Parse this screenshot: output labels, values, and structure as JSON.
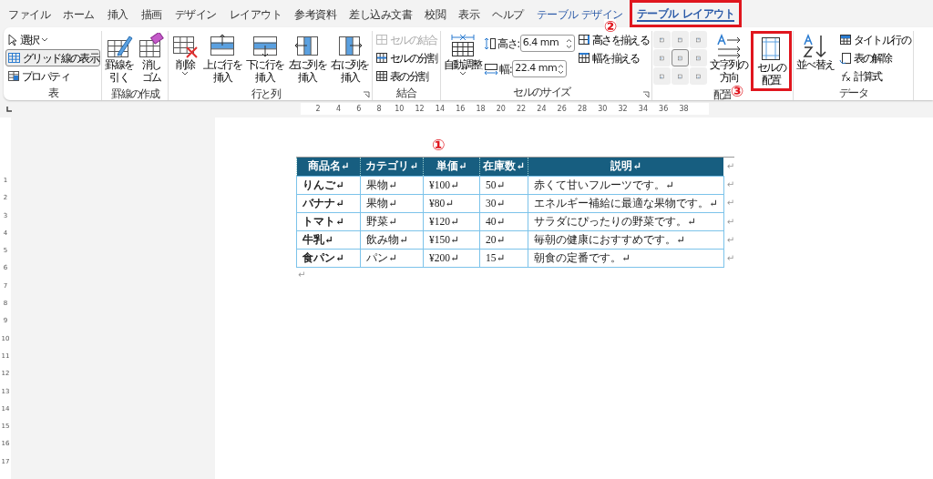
{
  "menu_tabs": [
    {
      "label": "ファイル",
      "kind": "normal",
      "selected": false,
      "highlighted": false
    },
    {
      "label": "ホーム",
      "kind": "normal",
      "selected": false,
      "highlighted": false
    },
    {
      "label": "挿入",
      "kind": "normal",
      "selected": false,
      "highlighted": false
    },
    {
      "label": "描画",
      "kind": "normal",
      "selected": false,
      "highlighted": false
    },
    {
      "label": "デザイン",
      "kind": "normal",
      "selected": false,
      "highlighted": false
    },
    {
      "label": "レイアウト",
      "kind": "normal",
      "selected": false,
      "highlighted": false
    },
    {
      "label": "参考資料",
      "kind": "normal",
      "selected": false,
      "highlighted": false
    },
    {
      "label": "差し込み文書",
      "kind": "normal",
      "selected": false,
      "highlighted": false
    },
    {
      "label": "校閲",
      "kind": "normal",
      "selected": false,
      "highlighted": false
    },
    {
      "label": "表示",
      "kind": "normal",
      "selected": false,
      "highlighted": false
    },
    {
      "label": "ヘルプ",
      "kind": "normal",
      "selected": false,
      "highlighted": false
    },
    {
      "label": "テーブル デザイン",
      "kind": "contextual",
      "selected": false,
      "highlighted": false
    },
    {
      "label": "テーブル レイアウト",
      "kind": "contextual",
      "selected": true,
      "highlighted": true
    }
  ],
  "ribbon": {
    "groups": [
      {
        "label": "表",
        "items": [
          {
            "kind": "small-dropdown",
            "label": "選択",
            "selected": false,
            "disabled": false
          },
          {
            "kind": "small",
            "label": "グリッド線の表示",
            "selected": true,
            "disabled": false
          },
          {
            "kind": "small",
            "label": "プロパティ",
            "selected": false,
            "disabled": false
          }
        ]
      },
      {
        "label": "罫線の作成",
        "items": [
          {
            "kind": "large",
            "lines": [
              "罫線を",
              "引く"
            ],
            "highlighted": false
          },
          {
            "kind": "large",
            "lines": [
              "消し",
              "ゴム"
            ],
            "highlighted": false
          }
        ]
      },
      {
        "label": "行と列",
        "launcher": true,
        "items": [
          {
            "kind": "large-dropdown",
            "lines": [
              "削除"
            ],
            "highlighted": false
          },
          {
            "kind": "large",
            "lines": [
              "上に行を",
              "挿入"
            ],
            "highlighted": false
          },
          {
            "kind": "large",
            "lines": [
              "下に行を",
              "挿入"
            ],
            "highlighted": false
          },
          {
            "kind": "large",
            "lines": [
              "左に列を",
              "挿入"
            ],
            "highlighted": false
          },
          {
            "kind": "large",
            "lines": [
              "右に列を",
              "挿入"
            ],
            "highlighted": false
          }
        ]
      },
      {
        "label": "結合",
        "items": [
          {
            "kind": "small",
            "label": "セルの結合",
            "selected": false,
            "disabled": true
          },
          {
            "kind": "small",
            "label": "セルの分割",
            "selected": false,
            "disabled": false
          },
          {
            "kind": "small",
            "label": "表の分割",
            "selected": false,
            "disabled": false
          }
        ]
      },
      {
        "label": "セルのサイズ",
        "launcher": true,
        "items": [
          {
            "kind": "large-dropdown",
            "lines": [
              "自動調整"
            ],
            "highlighted": false
          },
          {
            "kind": "field",
            "label": "高さ:",
            "value": "6.4 mm"
          },
          {
            "kind": "field",
            "label": "幅:",
            "value": "22.4 mm"
          },
          {
            "kind": "small",
            "label": "高さを揃える",
            "selected": false,
            "disabled": false
          },
          {
            "kind": "small",
            "label": "幅を揃える",
            "selected": false,
            "disabled": false
          }
        ]
      },
      {
        "label": "配置",
        "items": [
          {
            "kind": "align-grid",
            "cells": [
              {
                "selected": false
              },
              {
                "selected": false
              },
              {
                "selected": false
              },
              {
                "selected": false
              },
              {
                "selected": true
              },
              {
                "selected": false
              },
              {
                "selected": false
              },
              {
                "selected": false
              },
              {
                "selected": false
              }
            ]
          },
          {
            "kind": "large",
            "lines": [
              "文字列の",
              "方向"
            ],
            "highlighted": false
          },
          {
            "kind": "large",
            "lines": [
              "セルの",
              "配置"
            ],
            "highlighted": true
          }
        ]
      },
      {
        "label": "データ",
        "items": [
          {
            "kind": "large",
            "lines": [
              "並べ替え"
            ],
            "highlighted": false
          },
          {
            "kind": "small",
            "label": "タイトル行の",
            "selected": false,
            "disabled": false
          },
          {
            "kind": "small",
            "label": "表の解除",
            "selected": false,
            "disabled": false
          },
          {
            "kind": "small",
            "label": "計算式",
            "selected": false,
            "disabled": false
          }
        ]
      }
    ]
  },
  "annotations": [
    {
      "label": "①"
    },
    {
      "label": "②"
    },
    {
      "label": "③"
    }
  ],
  "ruler": {
    "labels": [
      "2",
      "4",
      "6",
      "8",
      "10",
      "12",
      "14",
      "16",
      "18",
      "20",
      "22",
      "24",
      "26",
      "28",
      "30",
      "32",
      "34",
      "36",
      "38"
    ]
  },
  "vertical_ruler": {
    "labels": [
      "1",
      "2",
      "3",
      "4",
      "5",
      "6",
      "7",
      "8",
      "9",
      "10",
      "11",
      "12",
      "13",
      "14",
      "15",
      "16",
      "17"
    ]
  },
  "document": {
    "table": {
      "columns": [
        {
          "label": "商品名↵"
        },
        {
          "label": "カテゴリ↵"
        },
        {
          "label": "単価↵"
        },
        {
          "label": "在庫数↵"
        },
        {
          "label": "説明↵"
        }
      ],
      "header_end": "↵",
      "rows": [
        {
          "cells": [
            "りんご↵",
            "果物↵",
            "¥100↵",
            "50↵",
            "赤くて甘いフルーツです。↵"
          ],
          "end": "↵"
        },
        {
          "cells": [
            "バナナ↵",
            "果物↵",
            "¥80↵",
            "30↵",
            "エネルギー補給に最適な果物です。↵"
          ],
          "end": "↵"
        },
        {
          "cells": [
            "トマト↵",
            "野菜↵",
            "¥120↵",
            "40↵",
            "サラダにぴったりの野菜です。↵"
          ],
          "end": "↵"
        },
        {
          "cells": [
            "牛乳↵",
            "飲み物↵",
            "¥150↵",
            "20↵",
            "毎朝の健康におすすめです。↵"
          ],
          "end": "↵"
        },
        {
          "cells": [
            "食パン↵",
            "パン↵",
            "¥200↵",
            "15↵",
            "朝食の定番です。↵"
          ],
          "end": "↵"
        }
      ]
    },
    "after_mark": "↵"
  }
}
